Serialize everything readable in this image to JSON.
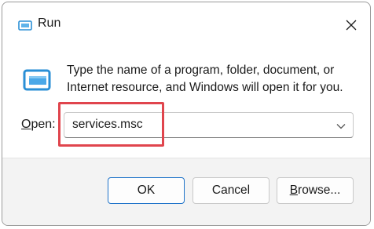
{
  "window": {
    "title": "Run"
  },
  "prompt": {
    "description": "Type the name of a program, folder, document, or Internet resource, and Windows will open it for you."
  },
  "open": {
    "label_accel": "O",
    "label_rest": "pen:",
    "value": "services.msc"
  },
  "buttons": {
    "ok": "OK",
    "cancel": "Cancel",
    "browse_accel": "B",
    "browse_rest": "rowse..."
  },
  "colors": {
    "highlight": "#e0454d",
    "accent": "#1f73c9",
    "icon_blue": "#2a8fd6"
  },
  "icons": {
    "app": "run-app-icon",
    "main": "run-program-icon",
    "close": "close-icon",
    "dropdown": "chevron-down-icon"
  }
}
